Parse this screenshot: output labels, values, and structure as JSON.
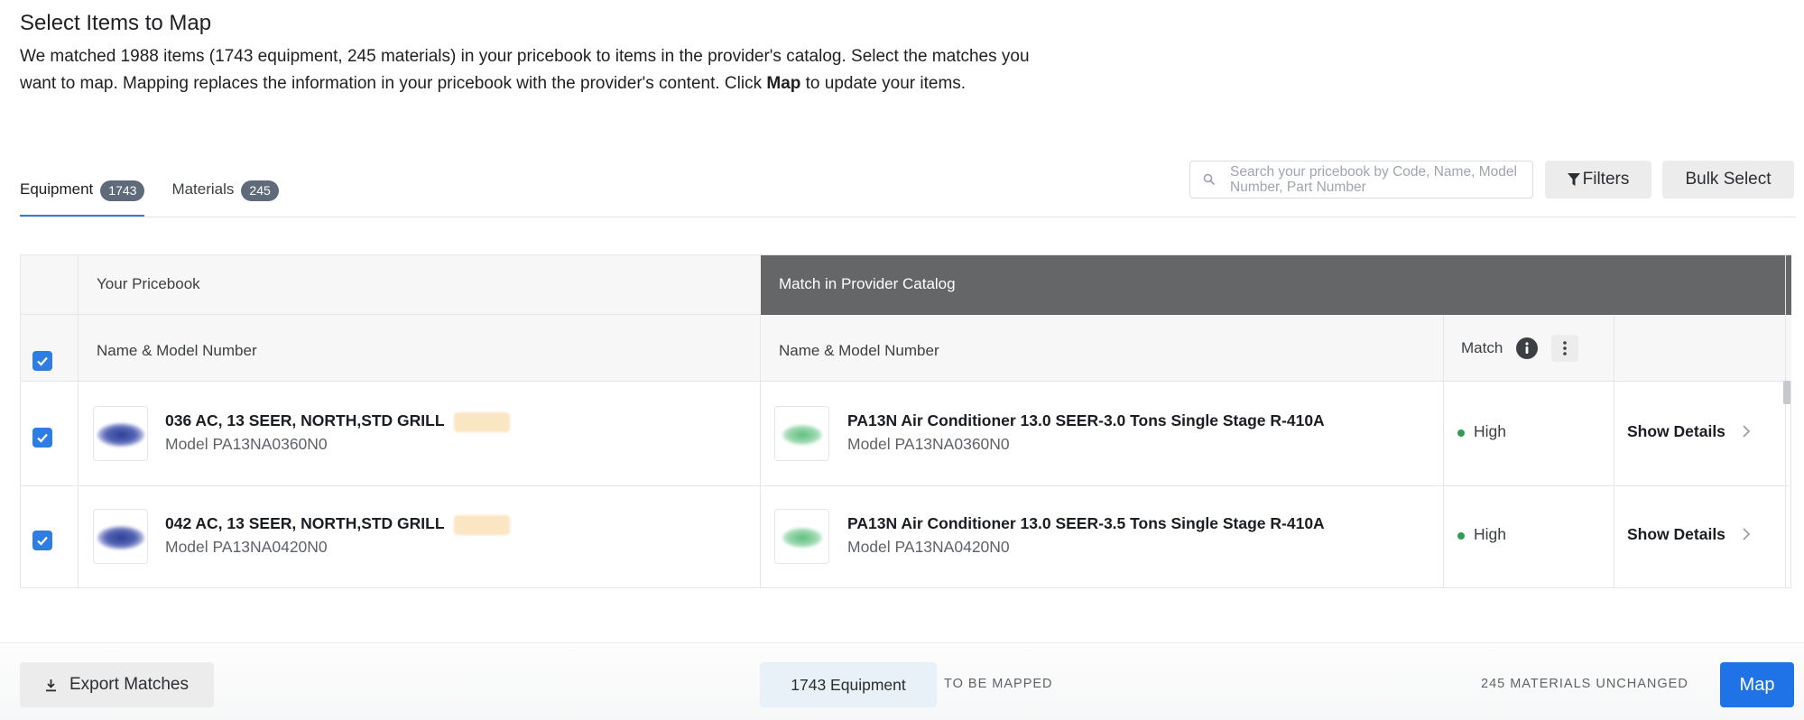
{
  "header": {
    "title": "Select Items to Map",
    "intro_text": "We matched 1988 items (1743 equipment, 245 materials) in your pricebook to items in the provider's catalog. Select the matches you want to map. Mapping replaces the information in your pricebook with the provider's content. Click",
    "intro_bold": "Map",
    "intro_end": "to update your items."
  },
  "tabs": [
    {
      "label": "Equipment",
      "count": "1743",
      "active": true
    },
    {
      "label": "Materials",
      "count": "245",
      "active": false
    }
  ],
  "toolbar": {
    "search_placeholder": "Search your pricebook by Code, Name, Model Number, Part Number",
    "filters_label": "Filters",
    "bulk_select_label": "Bulk Select"
  },
  "table": {
    "group_pricebook": "Your Pricebook",
    "group_catalog": "Match in Provider Catalog",
    "col_pricebook_name": "Name & Model Number",
    "col_catalog_name": "Name & Model Number",
    "col_match": "Match",
    "rows": [
      {
        "checked": true,
        "pricebook_name": "036 AC, 13 SEER, NORTH,STD GRILL",
        "pricebook_model": "Model PA13NA0360N0",
        "catalog_name": "PA13N Air Conditioner 13.0 SEER-3.0 Tons Single Stage R-410A",
        "catalog_model": "Model PA13NA0360N0",
        "match": "High",
        "details_label": "Show Details"
      },
      {
        "checked": true,
        "pricebook_name": "042 AC, 13 SEER, NORTH,STD GRILL",
        "pricebook_model": "Model PA13NA0420N0",
        "catalog_name": "PA13N Air Conditioner 13.0 SEER-3.5 Tons Single Stage R-410A",
        "catalog_model": "Model PA13NA0420N0",
        "match": "High",
        "details_label": "Show Details"
      }
    ]
  },
  "footer": {
    "export_label": "Export Matches",
    "equipment_count_label": "1743 Equipment",
    "to_be_mapped_label": "TO BE MAPPED",
    "unchanged_label": "245 MATERIALS UNCHANGED",
    "map_label": "Map"
  },
  "colors": {
    "accent": "#1f73e6",
    "checkbox": "#2f7de1",
    "catalog_header": "#656668",
    "match_high": "#2e9e56"
  }
}
